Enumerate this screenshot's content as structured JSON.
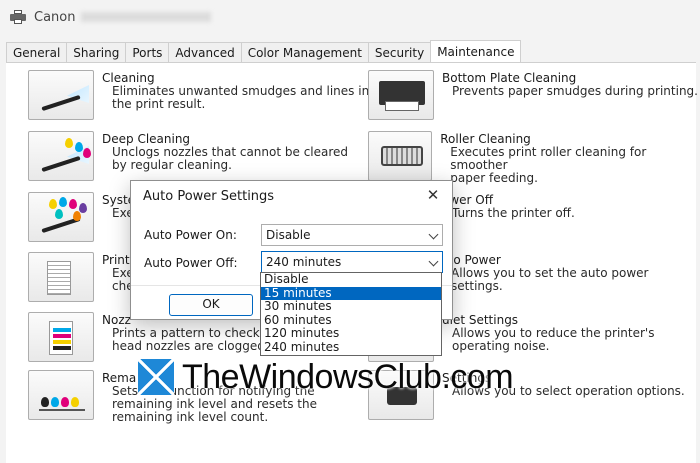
{
  "window": {
    "title": "Canon"
  },
  "tabs": [
    {
      "label": "General"
    },
    {
      "label": "Sharing"
    },
    {
      "label": "Ports"
    },
    {
      "label": "Advanced"
    },
    {
      "label": "Color Management"
    },
    {
      "label": "Security"
    },
    {
      "label": "Maintenance"
    }
  ],
  "left_items": [
    {
      "title": "Cleaning",
      "desc1": "Eliminates unwanted smudges and lines in",
      "desc2": "the print result."
    },
    {
      "title": "Deep Cleaning",
      "desc1": "Unclogs nozzles that cannot be cleared",
      "desc2": "by regular cleaning."
    },
    {
      "title": "Syste",
      "desc1": "Exe",
      "desc2": ""
    },
    {
      "title": "Print",
      "desc1": "Exe",
      "desc2": "che"
    },
    {
      "title": "Nozz",
      "desc1": "Prints a pattern to check wh",
      "desc2": "head nozzles are clogged."
    },
    {
      "title": "Rema",
      "desc1": "Sets the function for notifying the",
      "desc2": "remaining ink level and resets the",
      "desc3": "remaining ink level count."
    }
  ],
  "right_items": [
    {
      "title": "Bottom Plate Cleaning",
      "desc1": "Prevents paper smudges during printing.",
      "desc2": ""
    },
    {
      "title": "Roller Cleaning",
      "desc1": "Executes print roller cleaning for smoother",
      "desc2": "paper feeding."
    },
    {
      "title": "ower Off",
      "desc1": "Turns the printer off.",
      "desc2": ""
    },
    {
      "title": "uto Power",
      "desc1": "Allows you to set the auto power settings.",
      "desc2": ""
    },
    {
      "title": "uiet Settings",
      "desc1": "Allows you to reduce the printer's",
      "desc2": "operating noise."
    },
    {
      "title": "Settings",
      "desc1": "Allows you to select operation options.",
      "desc2": ""
    }
  ],
  "dialog": {
    "title": "Auto Power Settings",
    "close": "✕",
    "power_on_label": "Auto Power On:",
    "power_on_value": "Disable",
    "power_off_label": "Auto Power Off:",
    "power_off_value": "240 minutes",
    "ok_label": "OK",
    "options": [
      "Disable",
      "15 minutes",
      "30 minutes",
      "60 minutes",
      "120 minutes",
      "240 minutes"
    ],
    "highlighted_option": "15 minutes"
  },
  "watermark": {
    "text": "TheWindowsClub.com"
  },
  "colors": {
    "accent": "#0067c0",
    "logo_blue": "#1e88d7"
  }
}
